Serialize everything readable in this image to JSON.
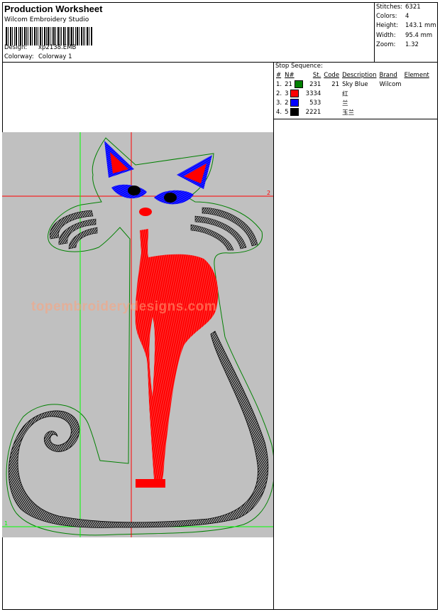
{
  "header": {
    "title": "Production Worksheet",
    "company": "Wilcom Embroidery Studio",
    "design_label": "Design:",
    "design_value": "xp2138.EMB",
    "colorway_label": "Colorway:",
    "colorway_value": "Colorway 1"
  },
  "stats": [
    {
      "label": "Stitches:",
      "value": "6321"
    },
    {
      "label": "Colors:",
      "value": "4"
    },
    {
      "label": "Height:",
      "value": "143.1 mm"
    },
    {
      "label": "Width:",
      "value": "95.4 mm"
    },
    {
      "label": "Zoom:",
      "value": "1.32"
    }
  ],
  "stop_sequence": {
    "title": "Stop Sequence:",
    "columns": [
      "#",
      "N#",
      "St.",
      "Code",
      "Description",
      "Brand",
      "Element"
    ],
    "rows": [
      {
        "num": "1.",
        "n": "21",
        "color": "#008000",
        "st": "231",
        "code": "21",
        "description": "Sky Blue",
        "brand": "Wilcom",
        "element": ""
      },
      {
        "num": "2.",
        "n": "3",
        "color": "#ff0000",
        "st": "3334",
        "code": "",
        "description": "红",
        "brand": "",
        "element": ""
      },
      {
        "num": "3.",
        "n": "2",
        "color": "#0000ff",
        "st": "533",
        "code": "",
        "description": "兰",
        "brand": "",
        "element": ""
      },
      {
        "num": "4.",
        "n": "5",
        "color": "#000000",
        "st": "2221",
        "code": "",
        "description": "玉兰",
        "brand": "",
        "element": ""
      }
    ]
  },
  "design": {
    "watermark": "topembroiderydesigns.com",
    "marker_top_right": "2",
    "marker_bottom_left": "1",
    "colors": {
      "background": "#c0c0c0",
      "outline": "#008000",
      "fill_red": "#ff0000",
      "fill_blue": "#0000ff",
      "fill_black": "#000000",
      "guide_red": "#ff0000",
      "guide_green": "#00ff00"
    }
  }
}
